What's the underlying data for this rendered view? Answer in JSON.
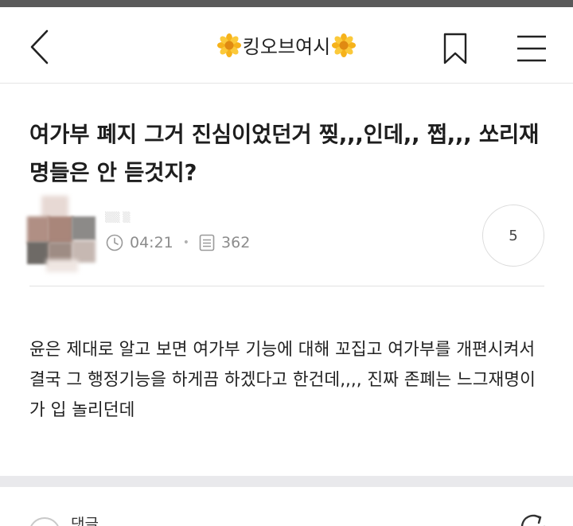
{
  "header": {
    "title": "킹오브여시",
    "back_icon": "chevron-left-icon",
    "bookmark_icon": "bookmark-icon",
    "menu_icon": "hamburger-menu-icon",
    "flower_icon": "sunflower-emoji"
  },
  "post": {
    "title": "여가부 폐지 그거 진심이었던거 찢,,,인데,, 쩝,,, 쏘리재명들은 안 듣것지?",
    "time": "04:21",
    "views": "362",
    "comment_count": "5",
    "body": "윤은 제대로 알고 보면 여가부 기능에 대해 꼬집고 여가부를 개편시켜서 결국 그 행정기능을 하게끔 하겠다고 한건데,,,, 진짜 존폐는 느그재명이가 입 놀리던데"
  },
  "comments": {
    "label": "댓글"
  },
  "colors": {
    "text": "#222222",
    "meta": "#8c8c8c",
    "divider": "#e2e2e2",
    "band": "#e9e9ec"
  }
}
